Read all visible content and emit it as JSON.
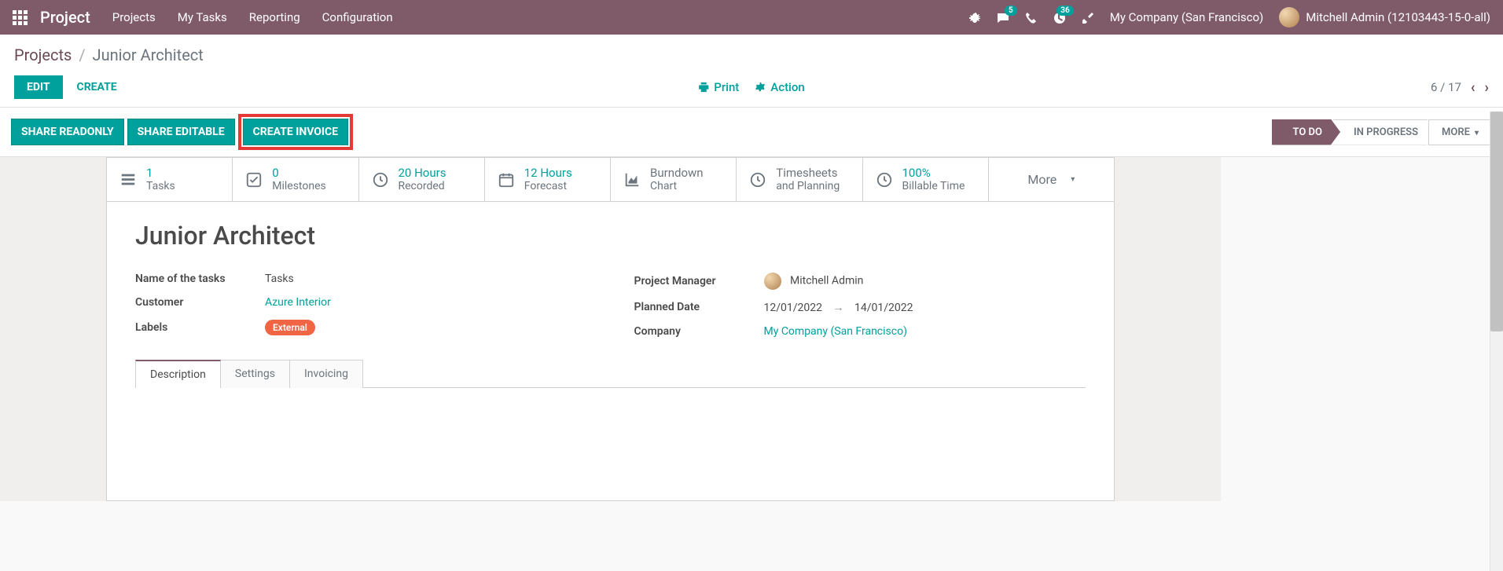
{
  "topnav": {
    "brand": "Project",
    "links": [
      "Projects",
      "My Tasks",
      "Reporting",
      "Configuration"
    ],
    "chat_badge": "5",
    "activity_badge": "36",
    "company": "My Company (San Francisco)",
    "user": "Mitchell Admin (12103443-15-0-all)"
  },
  "breadcrumb": {
    "parent": "Projects",
    "current": "Junior Architect"
  },
  "buttons": {
    "edit": "EDIT",
    "create": "CREATE",
    "print": "Print",
    "action": "Action",
    "share_readonly": "SHARE READONLY",
    "share_editable": "SHARE EDITABLE",
    "create_invoice": "CREATE INVOICE"
  },
  "pager": "6 / 17",
  "stages": {
    "todo": "TO DO",
    "in_progress": "IN PROGRESS",
    "more": "MORE"
  },
  "stats": {
    "tasks": {
      "num": "1",
      "label": "Tasks"
    },
    "milestones": {
      "num": "0",
      "label": "Milestones"
    },
    "recorded": {
      "num": "20 Hours",
      "label": "Recorded"
    },
    "forecast": {
      "num": "12 Hours",
      "label": "Forecast"
    },
    "burndown": {
      "num": "Burndown",
      "label": "Chart"
    },
    "timesheets": {
      "num": "Timesheets",
      "label": "and Planning"
    },
    "billable": {
      "num": "100%",
      "label": "Billable Time"
    },
    "more": "More"
  },
  "record": {
    "title": "Junior Architect",
    "labels": {
      "name_of_tasks": "Name of the tasks",
      "customer": "Customer",
      "labels_field": "Labels",
      "project_manager": "Project Manager",
      "planned_date": "Planned Date",
      "company": "Company"
    },
    "values": {
      "name_of_tasks": "Tasks",
      "customer": "Azure Interior",
      "tag": "External",
      "project_manager": "Mitchell Admin",
      "date_start": "12/01/2022",
      "date_end": "14/01/2022",
      "company": "My Company (San Francisco)"
    }
  },
  "tabs": {
    "description": "Description",
    "settings": "Settings",
    "invoicing": "Invoicing"
  }
}
